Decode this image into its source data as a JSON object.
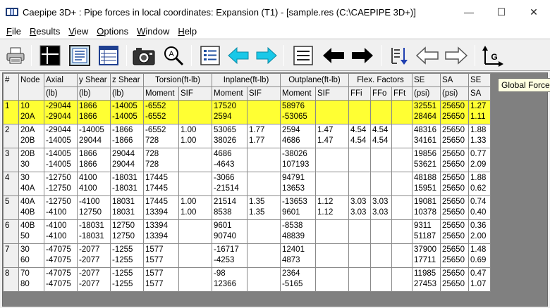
{
  "window": {
    "title": "Caepipe 3D+ : Pipe forces in local coordinates: Expansion (T1) -   [sample.res (C:\\CAEPIPE 3D+)]",
    "minimize_glyph": "—",
    "maximize_glyph": "☐",
    "close_glyph": "✕"
  },
  "menu": [
    {
      "first": "F",
      "rest": "ile"
    },
    {
      "first": "R",
      "rest": "esults"
    },
    {
      "first": "V",
      "rest": "iew"
    },
    {
      "first": "O",
      "rest": "ptions"
    },
    {
      "first": "W",
      "rest": "indow"
    },
    {
      "first": "H",
      "rest": "elp"
    }
  ],
  "toolbar": {
    "icons": [
      "printer-icon",
      "grid-cross-icon",
      "text-report-icon",
      "table-view-icon",
      "camera-icon",
      "zoom-icon",
      "list-icon",
      "arrow-left-cyan-icon",
      "arrow-right-cyan-icon",
      "lines-icon",
      "arrow-left-black-icon",
      "arrow-right-black-icon",
      "sort-down-icon",
      "arrow-left-outline-icon",
      "arrow-right-outline-icon",
      "global-axes-icon"
    ],
    "global_axis_letter": "G"
  },
  "tooltip": "Global Force",
  "grid": {
    "header_top": [
      "#",
      "Node",
      "Axial",
      "y Shear",
      "z Shear",
      "Torsion(ft-lb)",
      "Inplane(ft-lb)",
      "Outplane(ft-lb)",
      "Flex. Factors",
      "SE",
      "SA",
      "SE"
    ],
    "header_bottom": [
      "(lb)",
      "(lb)",
      "(lb)",
      "Moment",
      "SIF",
      "Moment",
      "SIF",
      "Moment",
      "SIF",
      "FFi",
      "FFo",
      "FFt",
      "(psi)",
      "(psi)",
      "SA"
    ],
    "rows": [
      {
        "num": "1",
        "node": [
          "10",
          "20A"
        ],
        "axial": [
          "-29044",
          "-29044"
        ],
        "yshear": [
          "1866",
          "1866"
        ],
        "zshear": [
          "-14005",
          "-14005"
        ],
        "tmom": [
          "-6552",
          "-6552"
        ],
        "tsif": [
          "",
          ""
        ],
        "imom": [
          "17520",
          "2594"
        ],
        "isif": [
          "",
          ""
        ],
        "omom": [
          "58976",
          "-53065"
        ],
        "osif": [
          "",
          ""
        ],
        "ffi": [
          "",
          ""
        ],
        "ffo": [
          "",
          ""
        ],
        "fft": [
          "",
          ""
        ],
        "se": [
          "32551",
          "28464"
        ],
        "sa": [
          "25650",
          "25650"
        ],
        "ratio": [
          "1.27",
          "1.11"
        ]
      },
      {
        "num": "2",
        "node": [
          "20A",
          "20B"
        ],
        "axial": [
          "-29044",
          "-14005"
        ],
        "yshear": [
          "-14005",
          "29044"
        ],
        "zshear": [
          "-1866",
          "-1866"
        ],
        "tmom": [
          "-6552",
          "728"
        ],
        "tsif": [
          "1.00",
          "1.00"
        ],
        "imom": [
          "53065",
          "38026"
        ],
        "isif": [
          "1.77",
          "1.77"
        ],
        "omom": [
          "2594",
          "4686"
        ],
        "osif": [
          "1.47",
          "1.47"
        ],
        "ffi": [
          "4.54",
          "4.54"
        ],
        "ffo": [
          "4.54",
          "4.54"
        ],
        "fft": [
          "",
          ""
        ],
        "se": [
          "48316",
          "34161"
        ],
        "sa": [
          "25650",
          "25650"
        ],
        "ratio": [
          "1.88",
          "1.33"
        ]
      },
      {
        "num": "3",
        "node": [
          "20B",
          "30"
        ],
        "axial": [
          "-14005",
          "-14005"
        ],
        "yshear": [
          "1866",
          "1866"
        ],
        "zshear": [
          "29044",
          "29044"
        ],
        "tmom": [
          "728",
          "728"
        ],
        "tsif": [
          "",
          ""
        ],
        "imom": [
          "4686",
          "-4643"
        ],
        "isif": [
          "",
          ""
        ],
        "omom": [
          "-38026",
          "107193"
        ],
        "osif": [
          "",
          ""
        ],
        "ffi": [
          "",
          ""
        ],
        "ffo": [
          "",
          ""
        ],
        "fft": [
          "",
          ""
        ],
        "se": [
          "19856",
          "53621"
        ],
        "sa": [
          "25650",
          "25650"
        ],
        "ratio": [
          "0.77",
          "2.09"
        ]
      },
      {
        "num": "4",
        "node": [
          "30",
          "40A"
        ],
        "axial": [
          "-12750",
          "-12750"
        ],
        "yshear": [
          "4100",
          "4100"
        ],
        "zshear": [
          "-18031",
          "-18031"
        ],
        "tmom": [
          "17445",
          "17445"
        ],
        "tsif": [
          "",
          ""
        ],
        "imom": [
          "-3066",
          "-21514"
        ],
        "isif": [
          "",
          ""
        ],
        "omom": [
          "94791",
          "13653"
        ],
        "osif": [
          "",
          ""
        ],
        "ffi": [
          "",
          ""
        ],
        "ffo": [
          "",
          ""
        ],
        "fft": [
          "",
          ""
        ],
        "se": [
          "48188",
          "15951"
        ],
        "sa": [
          "25650",
          "25650"
        ],
        "ratio": [
          "1.88",
          "0.62"
        ]
      },
      {
        "num": "5",
        "node": [
          "40A",
          "40B"
        ],
        "axial": [
          "-12750",
          "-4100"
        ],
        "yshear": [
          "-4100",
          "12750"
        ],
        "zshear": [
          "18031",
          "18031"
        ],
        "tmom": [
          "17445",
          "13394"
        ],
        "tsif": [
          "1.00",
          "1.00"
        ],
        "imom": [
          "21514",
          "8538"
        ],
        "isif": [
          "1.35",
          "1.35"
        ],
        "omom": [
          "-13653",
          "9601"
        ],
        "osif": [
          "1.12",
          "1.12"
        ],
        "ffi": [
          "3.03",
          "3.03"
        ],
        "ffo": [
          "3.03",
          "3.03"
        ],
        "fft": [
          "",
          ""
        ],
        "se": [
          "19081",
          "10378"
        ],
        "sa": [
          "25650",
          "25650"
        ],
        "ratio": [
          "0.74",
          "0.40"
        ]
      },
      {
        "num": "6",
        "node": [
          "40B",
          "50"
        ],
        "axial": [
          "-4100",
          "-4100"
        ],
        "yshear": [
          "-18031",
          "-18031"
        ],
        "zshear": [
          "12750",
          "12750"
        ],
        "tmom": [
          "13394",
          "13394"
        ],
        "tsif": [
          "",
          ""
        ],
        "imom": [
          "9601",
          "90740"
        ],
        "isif": [
          "",
          ""
        ],
        "omom": [
          "-8538",
          "48839"
        ],
        "osif": [
          "",
          ""
        ],
        "ffi": [
          "",
          ""
        ],
        "ffo": [
          "",
          ""
        ],
        "fft": [
          "",
          ""
        ],
        "se": [
          "9311",
          "51187"
        ],
        "sa": [
          "25650",
          "25650"
        ],
        "ratio": [
          "0.36",
          "2.00"
        ]
      },
      {
        "num": "7",
        "node": [
          "30",
          "60"
        ],
        "axial": [
          "-47075",
          "-47075"
        ],
        "yshear": [
          "-2077",
          "-2077"
        ],
        "zshear": [
          "-1255",
          "-1255"
        ],
        "tmom": [
          "1577",
          "1577"
        ],
        "tsif": [
          "",
          ""
        ],
        "imom": [
          "-16717",
          "-4253"
        ],
        "isif": [
          "",
          ""
        ],
        "omom": [
          "12401",
          "4873"
        ],
        "osif": [
          "",
          ""
        ],
        "ffi": [
          "",
          ""
        ],
        "ffo": [
          "",
          ""
        ],
        "fft": [
          "",
          ""
        ],
        "se": [
          "37900",
          "17711"
        ],
        "sa": [
          "25650",
          "25650"
        ],
        "ratio": [
          "1.48",
          "0.69"
        ]
      },
      {
        "num": "8",
        "node": [
          "70",
          "80"
        ],
        "axial": [
          "-47075",
          "-47075"
        ],
        "yshear": [
          "-2077",
          "-2077"
        ],
        "zshear": [
          "-1255",
          "-1255"
        ],
        "tmom": [
          "1577",
          "1577"
        ],
        "tsif": [
          "",
          ""
        ],
        "imom": [
          "-98",
          "12366"
        ],
        "isif": [
          "",
          ""
        ],
        "omom": [
          "2364",
          "-5165"
        ],
        "osif": [
          "",
          ""
        ],
        "ffi": [
          "",
          ""
        ],
        "ffo": [
          "",
          ""
        ],
        "fft": [
          "",
          ""
        ],
        "se": [
          "11985",
          "27453"
        ],
        "sa": [
          "25650",
          "25650"
        ],
        "ratio": [
          "0.47",
          "1.07"
        ]
      }
    ],
    "selected_row": 0,
    "colors": {
      "selected": "#ffff33",
      "header": "#f0f0f0",
      "empty_area": "#808080"
    }
  }
}
